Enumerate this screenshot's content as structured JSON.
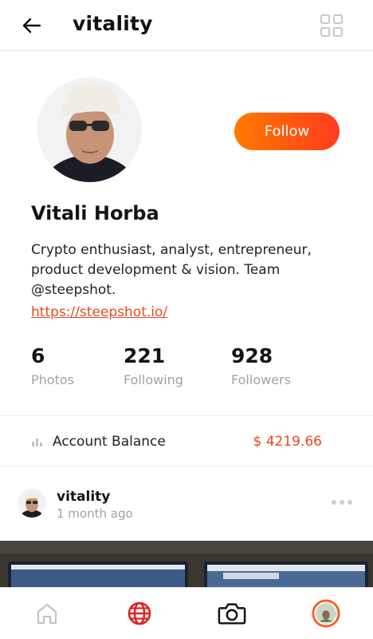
{
  "header": {
    "title": "vitality",
    "back_icon": "arrow-left-icon",
    "grid_icon": "grid-icon"
  },
  "profile": {
    "name": "Vitali Horba",
    "bio": "Crypto enthusiast, analyst, entrepreneur, product development & vision. Team @steepshot.",
    "link": "https://steepshot.io/",
    "follow_label": "Follow",
    "stats": [
      {
        "value": "6",
        "label": "Photos"
      },
      {
        "value": "221",
        "label": "Following"
      },
      {
        "value": "928",
        "label": "Followers"
      }
    ]
  },
  "balance": {
    "label": "Account Balance",
    "value": "$ 4219.66",
    "icon": "bar-chart-icon"
  },
  "post": {
    "username": "vitality",
    "time": "1 month ago",
    "more_icon": "more-dots-icon"
  },
  "bottom_nav": {
    "items": [
      "home-icon",
      "globe-icon",
      "camera-icon",
      "profile-avatar"
    ]
  },
  "colors": {
    "accent": "#e8491d",
    "follow_gradient_start": "#ff7a00",
    "follow_gradient_end": "#ff3c1e",
    "muted": "#a2a2a2",
    "globe": "#e02020"
  }
}
